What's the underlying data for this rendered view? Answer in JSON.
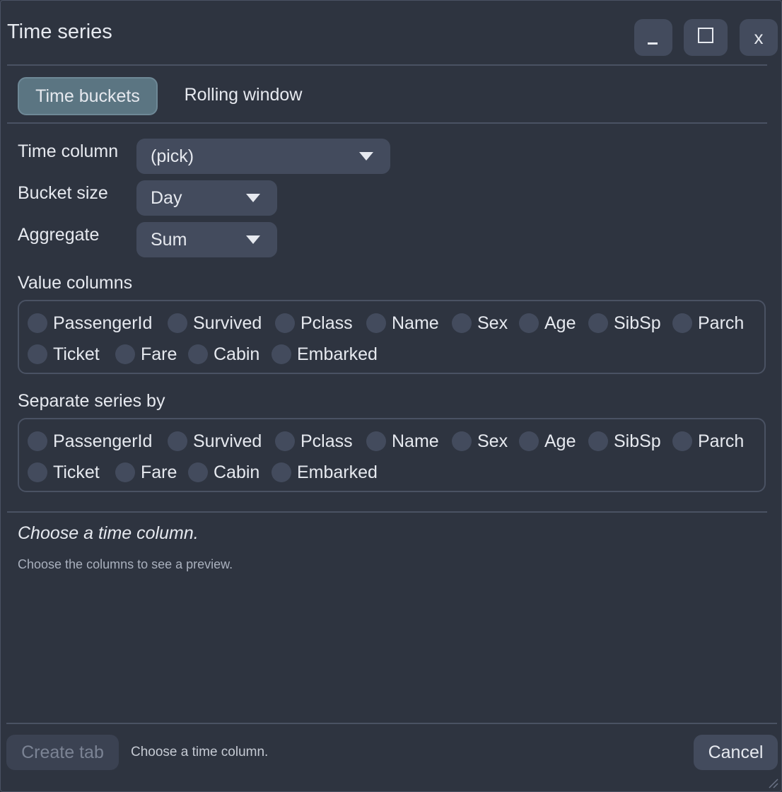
{
  "window": {
    "title": "Time series",
    "minimize_label": "_",
    "close_label": "x"
  },
  "tabs": [
    {
      "label": "Time buckets",
      "active": true
    },
    {
      "label": "Rolling window",
      "active": false
    }
  ],
  "form": {
    "time_column": {
      "label": "Time column",
      "value": "(pick)"
    },
    "bucket_size": {
      "label": "Bucket size",
      "value": "Day"
    },
    "aggregate": {
      "label": "Aggregate",
      "value": "Sum"
    }
  },
  "value_columns": {
    "label": "Value columns",
    "options": [
      "PassengerId",
      "Survived",
      "Pclass",
      "Name",
      "Sex",
      "Age",
      "SibSp",
      "Parch",
      "Ticket",
      "Fare",
      "Cabin",
      "Embarked"
    ]
  },
  "separate_series": {
    "label": "Separate series by",
    "options": [
      "PassengerId",
      "Survived",
      "Pclass",
      "Name",
      "Sex",
      "Age",
      "SibSp",
      "Parch",
      "Ticket",
      "Fare",
      "Cabin",
      "Embarked"
    ]
  },
  "status": {
    "title": "Choose a time column.",
    "subtitle": "Choose the columns to see a preview."
  },
  "footer": {
    "create_label": "Create tab",
    "message": "Choose a time column.",
    "cancel_label": "Cancel"
  },
  "colors": {
    "background": "#2e3440",
    "control": "#434b5d",
    "active_tab": "#5b7582",
    "border": "#4a5263",
    "text": "#e6e9ef"
  },
  "icons": {
    "minimize": "minimize-icon",
    "maximize": "maximize-icon",
    "close": "close-icon",
    "dropdown": "chevron-down-icon",
    "resize": "resize-grip-icon"
  }
}
